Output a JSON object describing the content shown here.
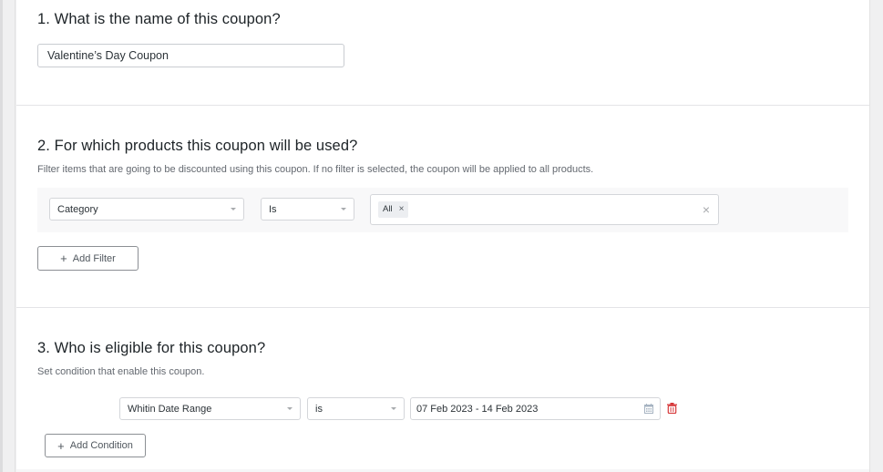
{
  "sections": {
    "name": {
      "title": "1. What is the name of this coupon?",
      "input_value": "Valentine’s Day Coupon"
    },
    "products": {
      "title": "2. For which products this coupon will be used?",
      "description": "Filter items that are going to be discounted using this coupon. If no filter is selected, the coupon will be applied to all products.",
      "filter": {
        "field": "Category",
        "operator": "Is",
        "values": [
          "All"
        ],
        "tag_remove": "×",
        "clear": "×"
      },
      "add_filter_label": "Add Filter",
      "add_icon": "+"
    },
    "eligibility": {
      "title": "3. Who is eligible for this coupon?",
      "description": "Set condition that enable this coupon.",
      "condition": {
        "field": "Whitin Date Range",
        "operator": "is",
        "value": "07 Feb 2023 - 14 Feb 2023",
        "value_icon": "calendar-icon",
        "delete_icon": "trash-icon"
      },
      "add_condition_label": "Add Condition",
      "add_icon": "+"
    }
  },
  "colors": {
    "delete": "#d63638",
    "border": "#d4d6da",
    "button_border": "#8c8f94"
  }
}
